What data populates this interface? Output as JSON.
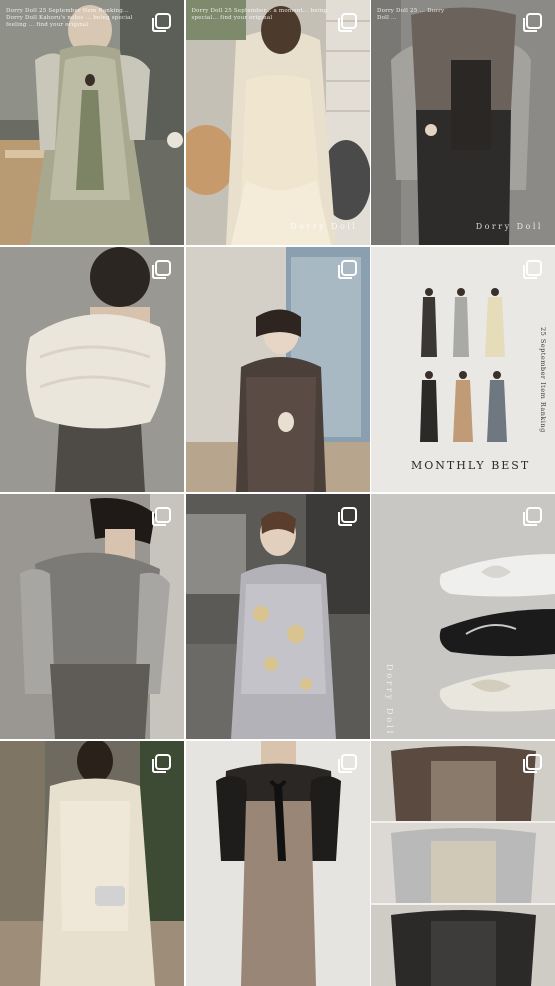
{
  "app": {
    "tiles": [
      {
        "id": "t1",
        "caption": "Dorry Doll 25 September Item Ranking... Dorry Doll Kahoru's notes ... being special feeling ... find your original",
        "brand": "Dorry Doll",
        "multi": true
      },
      {
        "id": "t2",
        "caption": "Dorry Doll 25 September... a moment... being special... find your original",
        "brand": "Dorry Doll",
        "multi": true
      },
      {
        "id": "t3",
        "caption": "Dorry Doll 25 ... Dorry Doll ...",
        "brand": "Dorry Doll",
        "multi": true
      },
      {
        "id": "t4",
        "multi": true
      },
      {
        "id": "t5",
        "multi": true
      },
      {
        "id": "t6",
        "multi": true,
        "title": "MONTHLY BEST",
        "side_label": "25 September Item Ranking"
      },
      {
        "id": "t7",
        "multi": true
      },
      {
        "id": "t8",
        "multi": true
      },
      {
        "id": "t9",
        "multi": true,
        "brand": "Dorry Doll"
      },
      {
        "id": "t10",
        "multi": true
      },
      {
        "id": "t11",
        "multi": true
      },
      {
        "id": "t12",
        "multi": true
      }
    ]
  },
  "colors": {
    "background": "#ffffff",
    "icon": "#ffffff"
  }
}
